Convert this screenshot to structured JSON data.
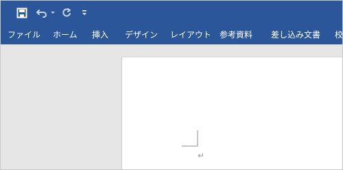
{
  "window": {
    "ribbon_tabs": [
      {
        "label": "ファイル"
      },
      {
        "label": "ホーム"
      },
      {
        "label": "挿入"
      },
      {
        "label": "デザイン"
      },
      {
        "label": "レイアウト"
      },
      {
        "label": "参考資料"
      },
      {
        "label": "差し込み文書"
      },
      {
        "label": "校"
      }
    ]
  },
  "quick_access": {
    "icons": [
      "save-icon",
      "undo-icon",
      "undo-dropdown-icon",
      "redo-icon",
      "customize-qat-icon"
    ]
  },
  "document": {
    "paragraph_mark": "↵"
  },
  "colors": {
    "ribbon": "#2b579a",
    "workspace": "#e6e6e6",
    "page": "#ffffff",
    "text_muted": "#9a9a9a"
  }
}
